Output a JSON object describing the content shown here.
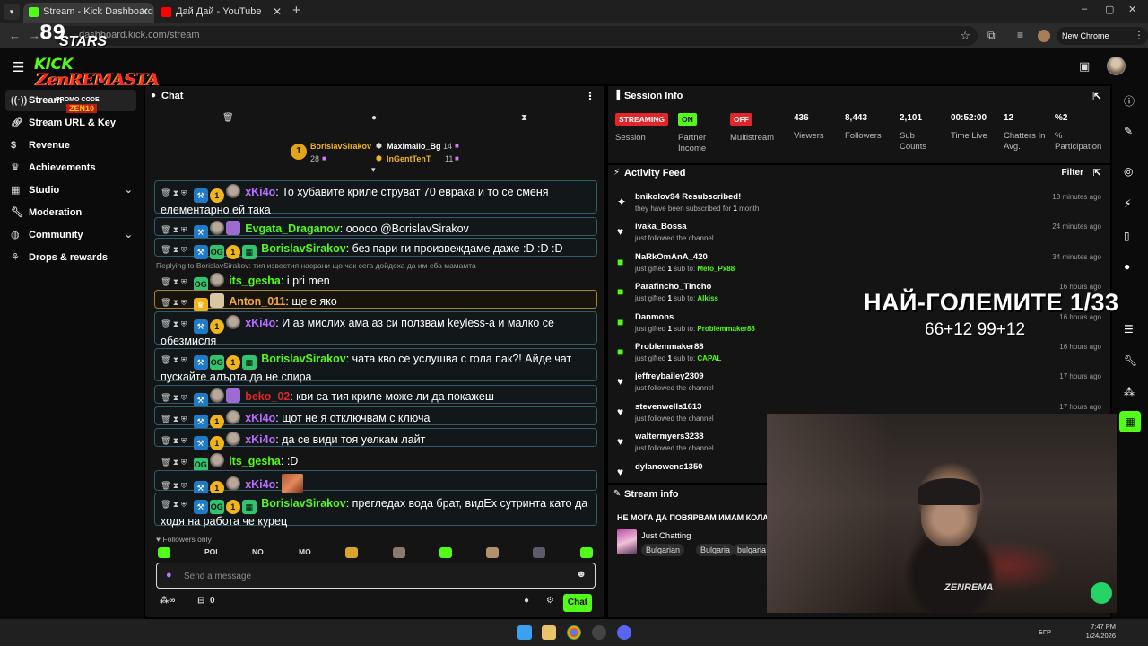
{
  "browser": {
    "tabs": [
      {
        "title": "Stream - Kick Dashboard",
        "favicon_color": "#53fc18"
      },
      {
        "title": "Дай Дай - YouTube",
        "favicon_color": "#ff0000"
      }
    ],
    "url": "dashboard.kick.com/stream",
    "new_chrome_label": "New Chrome available"
  },
  "logo": {
    "stars_num": "89",
    "stars_word": "STARS",
    "kick": "KICK",
    "zen": "ZenREMASTA",
    "promo": "PROMO CODE",
    "code": "ZEN10"
  },
  "sidebar": {
    "items": [
      {
        "label": "Stream",
        "icon": "broadcast-icon"
      },
      {
        "label": "Stream URL & Key",
        "icon": "link-icon"
      },
      {
        "label": "Revenue",
        "icon": "dollar-icon"
      },
      {
        "label": "Achievements",
        "icon": "trophy-icon"
      },
      {
        "label": "Studio",
        "icon": "grid-icon"
      },
      {
        "label": "Moderation",
        "icon": "wrench-icon"
      },
      {
        "label": "Community",
        "icon": "globe-icon"
      },
      {
        "label": "Drops & rewards",
        "icon": "gift-icon"
      }
    ]
  },
  "chat": {
    "title": "Chat",
    "pinned": [
      {
        "rank": "1",
        "name": "BorislavSirakov",
        "count": "28"
      },
      {
        "name": "Maximalio_Bg",
        "count": "14"
      },
      {
        "name": "InGentTenT",
        "count": "11"
      }
    ],
    "messages": [
      {
        "user": "xKi4o",
        "color": "#b96cff",
        "text": "То хубавите криле струват 70 еврака и то се сменя елементарно ей така"
      },
      {
        "user": "Evgata_Draganov",
        "color": "#53fc18",
        "text": "ооооо @BorislavSirakov"
      },
      {
        "user": "BorislavSirakov",
        "color": "#53fc18",
        "text": "без пари ги произвеждаме даже :D :D :D"
      },
      {
        "reply": "Replying to BorislavSirakov: тия известия насрани що чак сега дойдоха да им еба мамамта"
      },
      {
        "user": "its_gesha",
        "color": "#53fc18",
        "text": "i pri men"
      },
      {
        "user": "Anton_011",
        "color": "#f2a93b",
        "text": "ще е яко"
      },
      {
        "user": "xKi4o",
        "color": "#b96cff",
        "text": "И аз мислих ама аз си ползвам keyless-а и малко се обезмисля"
      },
      {
        "user": "BorislavSirakov",
        "color": "#53fc18",
        "text": "чата кво се услушва с гола пак?! Айде чат пускайте алърта да не спира"
      },
      {
        "user": "beko_02",
        "color": "#e0262a",
        "text": "кви са тия криле може ли да покажеш"
      },
      {
        "user": "xKi4o",
        "color": "#b96cff",
        "text": "щот не я отключвам с ключа"
      },
      {
        "user": "xKi4o",
        "color": "#b96cff",
        "text": "да се види тоя уелкам лайт"
      },
      {
        "user": "its_gesha",
        "color": "#53fc18",
        "text": ":D"
      },
      {
        "user": "xKi4o",
        "color": "#b96cff",
        "text": ""
      },
      {
        "user": "BorislavSirakov",
        "color": "#53fc18",
        "text": "прегледах вода брат, видЕх сутринта като да ходя на работа че курец"
      }
    ],
    "followers_only": "Followers only",
    "emote_labels": [
      "POL",
      "NO",
      "MO"
    ],
    "input_placeholder": "Send a message",
    "footer_count": "0",
    "send_label": "Chat"
  },
  "session": {
    "title": "Session Info",
    "streaming_pill": "STREAMING",
    "on_pill": "ON",
    "off_pill": "OFF",
    "labels": {
      "session": "Session",
      "partner": "Partner Income",
      "multistream": "Multistream",
      "viewers": "Viewers",
      "followers": "Followers",
      "subs": "Sub Counts",
      "time": "Time Live",
      "chatters": "Chatters In Avg.",
      "participation": "% Participation"
    },
    "values": {
      "viewers": "436",
      "followers": "8,443",
      "subs": "2,101",
      "time": "00:52:00",
      "chatters": "12",
      "participation": "%2"
    }
  },
  "activity": {
    "title": "Activity Feed",
    "filter_label": "Filter",
    "items": [
      {
        "type": "resub",
        "name": "bnikolov94 Resubscribed!",
        "desc_pre": "they have been subscribed for ",
        "desc_num": "1",
        "desc_post": " month",
        "time": "13 minutes ago"
      },
      {
        "type": "follow",
        "name": "ivaka_Bossa",
        "desc": "just followed the channel",
        "time": "24 minutes ago"
      },
      {
        "type": "gift",
        "name": "NaRkOmAnA_420",
        "desc_pre": "just gifted ",
        "desc_num": "1",
        "desc_post": " sub to: ",
        "target": "Meto_Px88",
        "time": "34 minutes ago"
      },
      {
        "type": "gift",
        "name": "Parafincho_Tincho",
        "desc_pre": "just gifted ",
        "desc_num": "1",
        "desc_post": " sub to: ",
        "target": "Alkiss",
        "time": "16 hours ago"
      },
      {
        "type": "gift",
        "name": "Danmons",
        "desc_pre": "just gifted ",
        "desc_num": "1",
        "desc_post": " sub to: ",
        "target": "Problemmaker88",
        "time": "16 hours ago"
      },
      {
        "type": "gift",
        "name": "Problemmaker88",
        "desc_pre": "just gifted ",
        "desc_num": "1",
        "desc_post": " sub to: ",
        "target": "CAPAL",
        "time": "16 hours ago"
      },
      {
        "type": "follow",
        "name": "jeffreybailey2309",
        "desc": "just followed the channel",
        "time": "17 hours ago"
      },
      {
        "type": "follow",
        "name": "stevenwells1613",
        "desc": "just followed the channel",
        "time": "17 hours ago"
      },
      {
        "type": "follow",
        "name": "waltermyers3238",
        "desc": "just followed the channel",
        "time": ""
      },
      {
        "type": "follow",
        "name": "dylanowens1350",
        "desc": "",
        "time": ""
      }
    ]
  },
  "stream_info": {
    "title": "Stream info",
    "stream_title": "НЕ МОГА ДА ПОВЯРВАМ ИМАМ КОЛА",
    "category": "Just Chatting",
    "tags": [
      "Bulgarian",
      "Bulgaria",
      "bulgaria"
    ]
  },
  "overlay": {
    "line1": "НАЙ-ГОЛЕМИТЕ 1/33",
    "line2": "66+12 99+12",
    "shirt_text": "ZENREMA"
  },
  "taskbar": {
    "lang": "БГР",
    "time": "7:47 PM",
    "date": "1/24/2026"
  },
  "colors": {
    "kick_green": "#53fc18",
    "panel_bg": "#141414",
    "page_bg": "#0b0b0b",
    "streaming_red": "#e0262a"
  }
}
